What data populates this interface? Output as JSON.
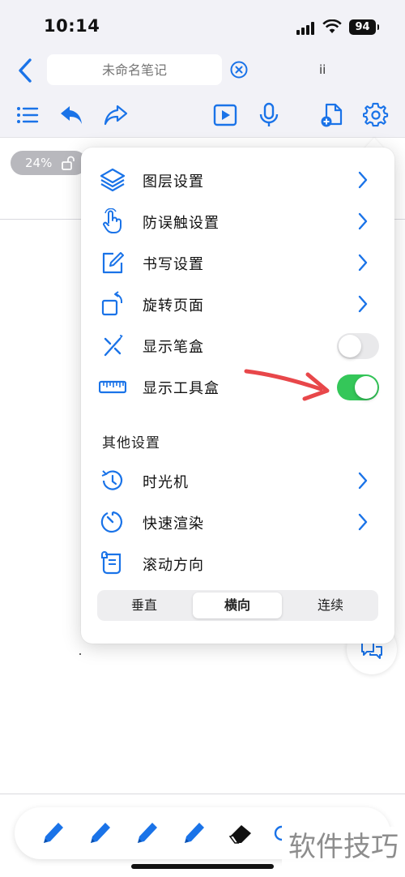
{
  "status_bar": {
    "time": "10:14",
    "battery": "94"
  },
  "navbar": {
    "title_placeholder": "未命名笔记",
    "extra": "ii"
  },
  "zoom": {
    "level": "24%"
  },
  "menu": {
    "items": [
      {
        "label": "图层设置",
        "icon": "layers-icon"
      },
      {
        "label": "防误触设置",
        "icon": "touch-hand-icon"
      },
      {
        "label": "书写设置",
        "icon": "edit-pen-icon"
      },
      {
        "label": "旋转页面",
        "icon": "rotate-page-icon"
      }
    ],
    "toggles": [
      {
        "label": "显示笔盒",
        "icon": "pen-box-icon",
        "on": false
      },
      {
        "label": "显示工具盒",
        "icon": "ruler-icon",
        "on": true
      }
    ],
    "other_header": "其他设置",
    "other_items": [
      {
        "label": "时光机",
        "icon": "history-icon"
      },
      {
        "label": "快速渲染",
        "icon": "timer-icon"
      }
    ],
    "scroll_label": "滚动方向",
    "scroll_options": [
      "垂直",
      "横向",
      "连续"
    ],
    "scroll_selected": "横向"
  },
  "watermark": "软件技巧",
  "colors": {
    "accent": "#1a73e8",
    "toggle_on": "#34c759",
    "annotation_arrow": "#e8474a"
  }
}
